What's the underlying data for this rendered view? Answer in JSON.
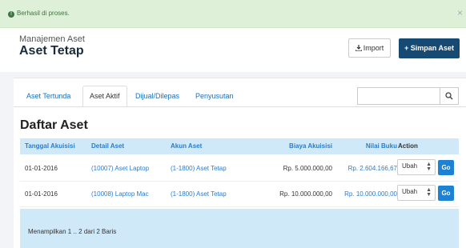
{
  "alert": {
    "message": "Berhasil di proses.",
    "close_label": "×"
  },
  "header": {
    "subtitle": "Manajemen Aset",
    "title": "Aset Tetap",
    "import_label": "Import",
    "save_label": "+ Simpan Aset"
  },
  "tabs": [
    {
      "label": "Aset Tertunda"
    },
    {
      "label": "Aset Aktif"
    },
    {
      "label": "Dijual/Dilepas"
    },
    {
      "label": "Penyusutan"
    }
  ],
  "active_tab": "Aset Aktif",
  "search": {
    "placeholder": ""
  },
  "list": {
    "title": "Daftar Aset",
    "columns": [
      "Tanggal Akuisisi",
      "Detail Aset",
      "Akun Aset",
      "Biaya Akuisisi",
      "Nilai Buku",
      "Action"
    ],
    "rows": [
      {
        "date": "01-01-2016",
        "detail": "(10007) Aset Laptop",
        "account": "(1-1800) Aset Tetap",
        "cost": "Rp. 5.000.000,00",
        "book_value": "Rp. 2.604.166,67",
        "action": "Ubah",
        "go": "Go"
      },
      {
        "date": "01-01-2016",
        "detail": "(10008) Laptop Mac",
        "account": "(1-1800) Aset Tetap",
        "cost": "Rp. 10.000.000,00",
        "book_value": "Rp. 10.000.000,00",
        "action": "Ubah",
        "go": "Go"
      }
    ],
    "footer": "Menampilkan 1 .. 2 dari 2 Baris"
  },
  "colors": {
    "primary_button": "#174a73",
    "go_button": "#1d82d4",
    "header_row": "#cfe9f8",
    "alert_bg": "#dff0d8"
  }
}
